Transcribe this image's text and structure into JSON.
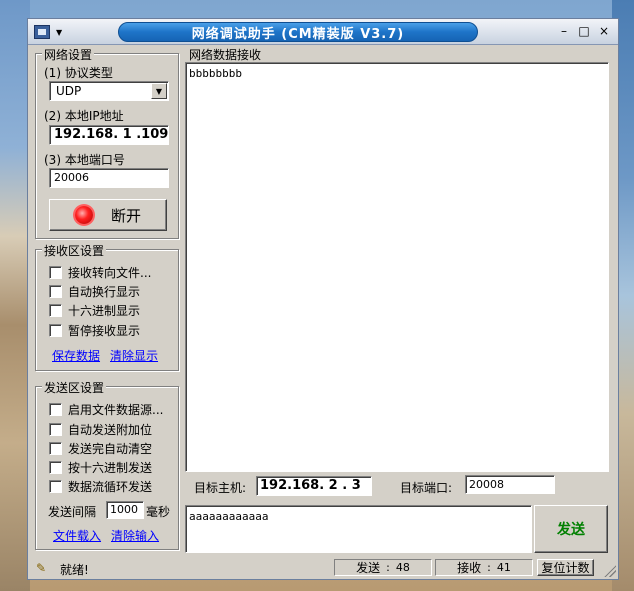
{
  "title": "网络调试助手 (CM精装版 V3.7)",
  "title_buttons": {
    "minimize": "–",
    "maximize": "□",
    "close": "×"
  },
  "net_settings": {
    "group_label": "网络设置",
    "protocol_label": "(1) 协议类型",
    "protocol_value": "UDP",
    "ip_label": "(2) 本地IP地址",
    "ip_value": "192.168. 1 .109",
    "port_label": "(3) 本地端口号",
    "port_value": "20006",
    "connect_button": "断开"
  },
  "recv_settings": {
    "group_label": "接收区设置",
    "options": [
      "接收转向文件...",
      "自动换行显示",
      "十六进制显示",
      "暂停接收显示"
    ],
    "save_link": "保存数据",
    "clear_link": "清除显示"
  },
  "send_settings": {
    "group_label": "发送区设置",
    "options": [
      "启用文件数据源...",
      "自动发送附加位",
      "发送完自动清空",
      "按十六进制发送",
      "数据流循环发送"
    ],
    "interval_label": "发送间隔",
    "interval_value": "1000",
    "interval_unit": "毫秒",
    "load_link": "文件载入",
    "clear_link": "清除输入"
  },
  "recv_area": {
    "group_label": "网络数据接收",
    "content": "bbbbbbbb"
  },
  "target": {
    "host_label": "目标主机:",
    "host_value": "192.168. 2 . 3",
    "port_label": "目标端口:",
    "port_value": "20008"
  },
  "send_area": {
    "content": "aaaaaaaaaaaa",
    "send_button": "发送"
  },
  "status": {
    "ready": "就绪!",
    "sent_label": "发送",
    "sent_count": "48",
    "recv_label": "接收",
    "recv_count": "41",
    "reset_button": "复位计数"
  }
}
